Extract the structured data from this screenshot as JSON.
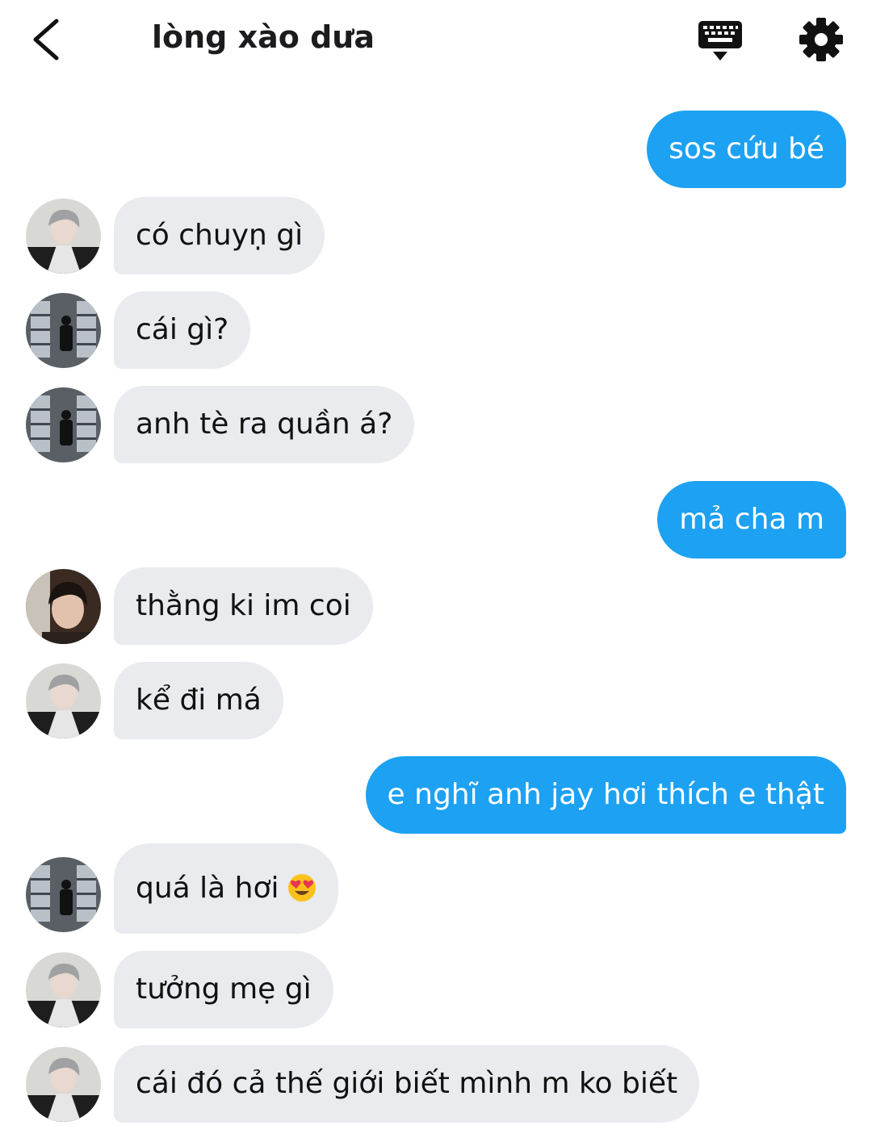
{
  "header": {
    "title": "lòng xào dưa",
    "icons": [
      "chevron-left-icon",
      "keyboard-icon",
      "gear-icon"
    ]
  },
  "colors": {
    "outgoing_bubble": "#1da1f2",
    "incoming_bubble": "#e9ebef"
  },
  "messages": [
    {
      "side": "out",
      "text": "sos cứu bé"
    },
    {
      "side": "in",
      "avatar": "avatar-silver-hair",
      "text": "có chuyṇ gì"
    },
    {
      "side": "in",
      "avatar": "avatar-store",
      "text": "cái gì?"
    },
    {
      "side": "in",
      "avatar": "avatar-store",
      "text": "anh tè ra quần á?"
    },
    {
      "side": "out",
      "text": "mả cha m"
    },
    {
      "side": "in",
      "avatar": "avatar-dark-hair",
      "text": "thằng ki im coi"
    },
    {
      "side": "in",
      "avatar": "avatar-silver-hair",
      "text": "kể đi má"
    },
    {
      "side": "out",
      "text": "e nghĩ anh jay hơi thích e thật"
    },
    {
      "side": "in",
      "avatar": "avatar-store",
      "text": "quá là hơi",
      "emoji": "heart-eyes-emoji"
    },
    {
      "side": "in",
      "avatar": "avatar-silver-hair",
      "text": "tưởng mẹ gì"
    },
    {
      "side": "in",
      "avatar": "avatar-silver-hair",
      "text": "cái đó cả thế giới biết mình m ko biết"
    }
  ]
}
